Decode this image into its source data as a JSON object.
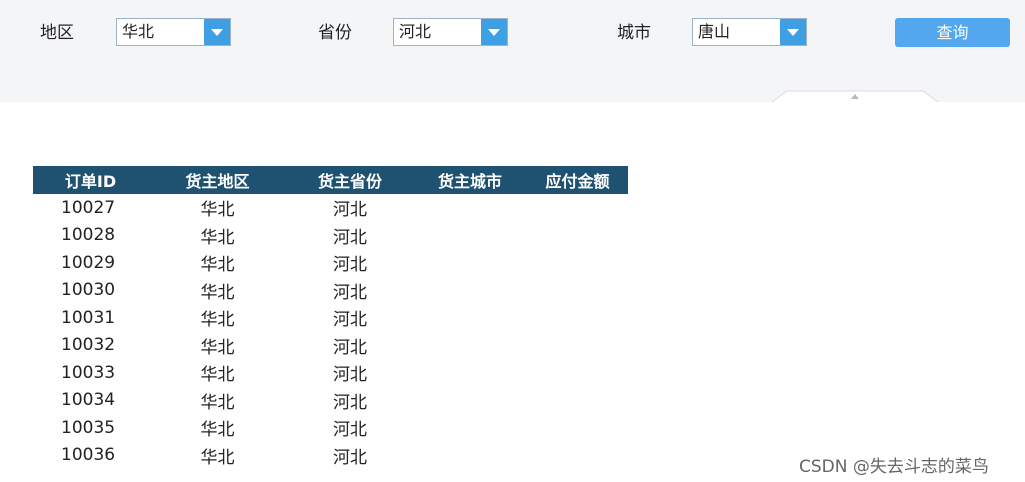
{
  "params": {
    "region": {
      "label": "地区",
      "value": "华北"
    },
    "province": {
      "label": "省份",
      "value": "河北"
    },
    "city": {
      "label": "城市",
      "value": "唐山"
    },
    "query_button": "查询"
  },
  "table": {
    "columns": [
      "订单ID",
      "货主地区",
      "货主省份",
      "货主城市",
      "应付金额"
    ],
    "rows": [
      [
        "10027",
        "华北",
        "河北",
        "",
        ""
      ],
      [
        "10028",
        "华北",
        "河北",
        "",
        ""
      ],
      [
        "10029",
        "华北",
        "河北",
        "",
        ""
      ],
      [
        "10030",
        "华北",
        "河北",
        "",
        ""
      ],
      [
        "10031",
        "华北",
        "河北",
        "",
        ""
      ],
      [
        "10032",
        "华北",
        "河北",
        "",
        ""
      ],
      [
        "10033",
        "华北",
        "河北",
        "",
        ""
      ],
      [
        "10034",
        "华北",
        "河北",
        "",
        ""
      ],
      [
        "10035",
        "华北",
        "河北",
        "",
        ""
      ],
      [
        "10036",
        "华北",
        "河北",
        "",
        ""
      ]
    ]
  },
  "watermark": "CSDN @失去斗志的菜鸟",
  "colors": {
    "header_bg": "#1e5270",
    "button": "#53a7ee",
    "dropdown_arrow": "#3f9fe3"
  }
}
